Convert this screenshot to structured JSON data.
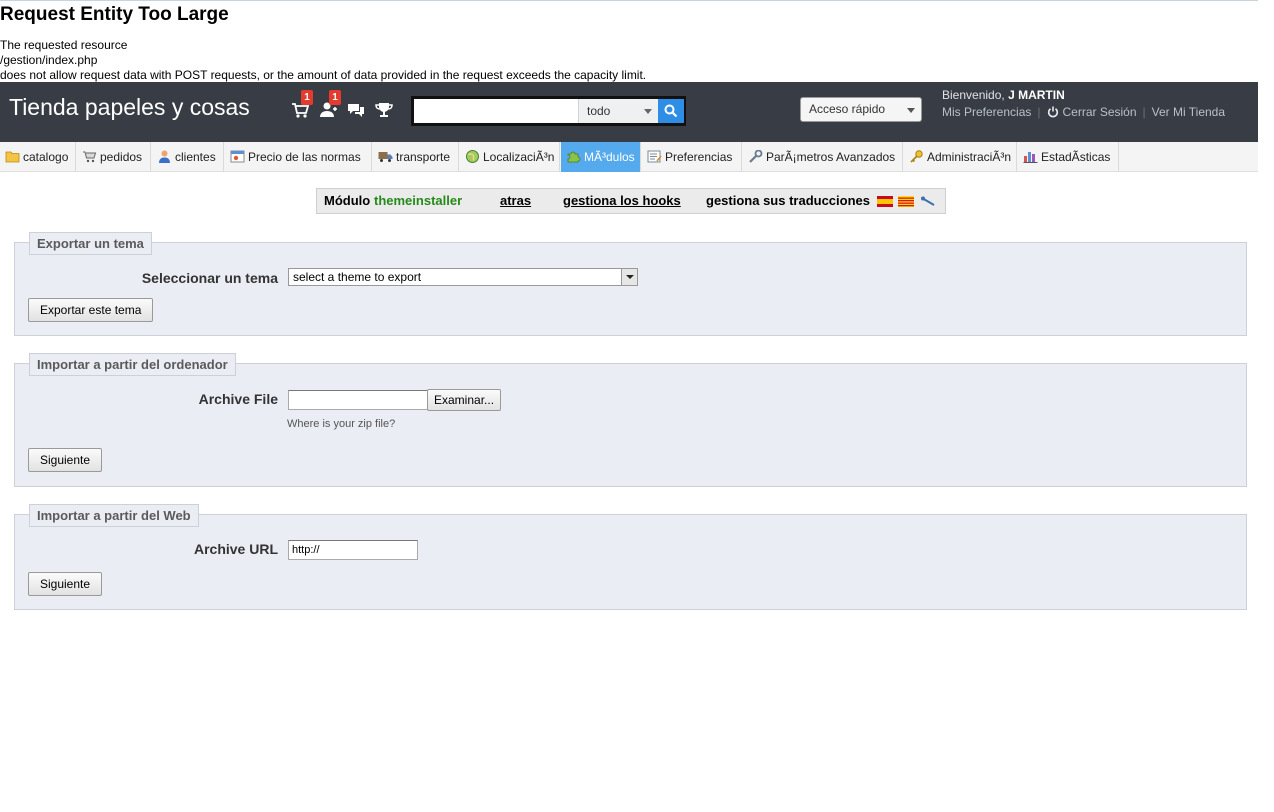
{
  "error": {
    "title": "Request Entity Too Large",
    "lines": [
      "The requested resource",
      "/gestion/index.php",
      "does not allow request data with POST requests, or the amount of data provided in the request exceeds the capacity limit."
    ]
  },
  "header": {
    "shop_name": "Tienda papeles y cosas",
    "orders_count": "1",
    "customers_count": "1",
    "search": {
      "value": "",
      "scope": "todo"
    },
    "quick_access": "Acceso rápido",
    "welcome_prefix": "Bienvenido,",
    "user_name": "J MARTIN",
    "links": [
      "Mis Preferencias",
      "Cerrar Sesión",
      "Ver Mi Tienda"
    ]
  },
  "tabs": [
    {
      "label": "catalogo",
      "icon": "folder-icon"
    },
    {
      "label": "pedidos",
      "icon": "cart-icon"
    },
    {
      "label": "clientes",
      "icon": "user-icon"
    },
    {
      "label": "Precio de las normas",
      "icon": "price-rules-icon"
    },
    {
      "label": "transporte",
      "icon": "truck-icon"
    },
    {
      "label": "LocalizaciÃ³n",
      "icon": "globe-icon"
    },
    {
      "label": "MÃ³dulos",
      "icon": "puzzle-icon",
      "active": true
    },
    {
      "label": "Preferencias",
      "icon": "preferences-icon"
    },
    {
      "label": "ParÃ¡metros Avanzados",
      "icon": "wrench-icon"
    },
    {
      "label": "AdministraciÃ³n",
      "icon": "key-icon"
    },
    {
      "label": "EstadÃ­sticas",
      "icon": "stats-icon"
    }
  ],
  "module_bar": {
    "prefix": "Módulo",
    "module_name": "themeinstaller",
    "back": "atras",
    "hooks": "gestiona los hooks",
    "translations": "gestiona sus traducciones"
  },
  "export": {
    "legend": "Exportar un tema",
    "select_label": "Seleccionar un tema",
    "select_value": "select a theme to export",
    "button": "Exportar este tema"
  },
  "import_computer": {
    "legend": "Importar a partir del ordenador",
    "file_label": "Archive File",
    "browse": "Examinar...",
    "hint": "Where is your zip file?",
    "button": "Siguiente"
  },
  "import_web": {
    "legend": "Importar a partir del Web",
    "url_label": "Archive URL",
    "url_value": "http://",
    "button": "Siguiente"
  },
  "colors": {
    "header_bg": "#383c44",
    "active_tab": "#55aaee",
    "module_green": "#258a19",
    "fieldset_bg": "#ebedf4",
    "badge_red": "#e53b2f"
  }
}
